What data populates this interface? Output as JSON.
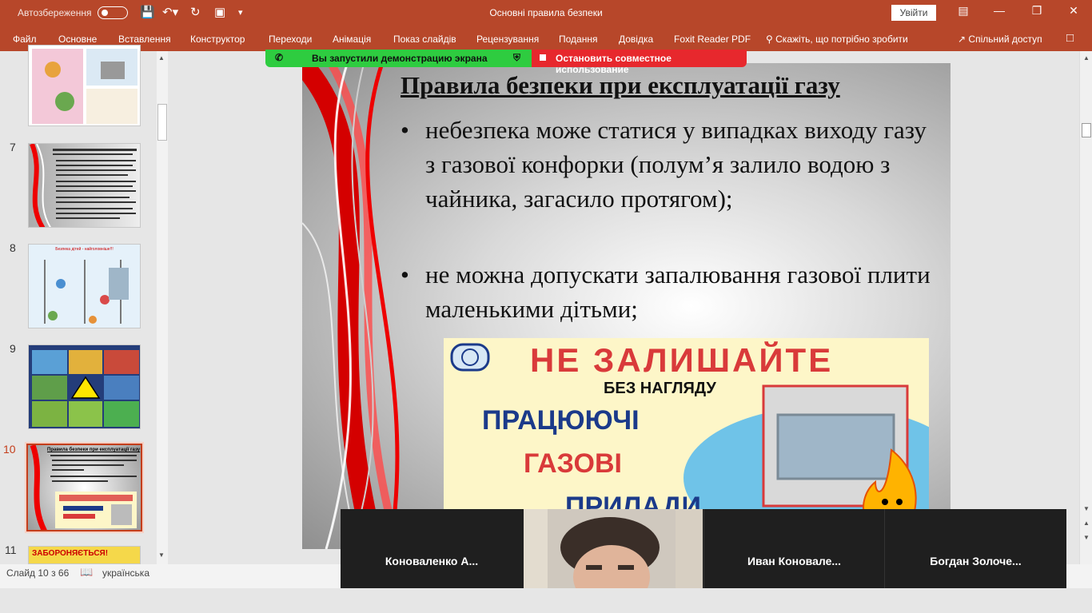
{
  "titlebar": {
    "autosave_label": "Автозбереження",
    "document_title": "Основні правила безпеки",
    "signin_label": "Увійти"
  },
  "ribbon": {
    "tabs": [
      "Файл",
      "Основне",
      "Вставлення",
      "Конструктор",
      "Переходи",
      "Анімація",
      "Показ слайдів",
      "Рецензування",
      "Подання",
      "Довідка",
      "Foxit Reader PDF"
    ],
    "tell_me": "Скажіть, що потрібно зробити",
    "share": "Спільний доступ"
  },
  "screen_share": {
    "status": "Вы запустили демонстрацию экрана",
    "stop_label": "Остановить совместное использование"
  },
  "thumbnails": {
    "numbers": [
      "7",
      "8",
      "9",
      "10",
      "11"
    ],
    "slide10_title": "Правила безпеки при експлуатації газу",
    "slide11_banner": "ЗАБОРОНЯЄТЬСЯ!",
    "slide8_title": "Безпека дітей - найголовніше!!!"
  },
  "slide": {
    "title": "Правила безпеки при експлуатації газу",
    "bullets": [
      "небезпека може статися у випадках виходу газу з газової конфорки (полум’я залило водою з чайника, загасило протягом);",
      "не можна допускати запалювання газової плити маленькими дітьми;"
    ],
    "bullet_char": "•",
    "poster": {
      "line1": "НЕ ЗАЛИШАЙТЕ",
      "line2": "БЕЗ НАГЛЯДУ",
      "line3": "ПРАЦЮЮЧІ",
      "line4": "ГАЗОВІ",
      "line5": "ПРИЛАДИ"
    }
  },
  "status": {
    "slide_info": "Слайд 10 з 66",
    "language": "українська"
  },
  "participants": [
    "Коноваленко А...",
    "Иван Коновале...",
    "Богдан Золоче..."
  ],
  "colors": {
    "accent": "#b7472a",
    "share_green": "#2ecc40",
    "share_red": "#e7282d"
  }
}
